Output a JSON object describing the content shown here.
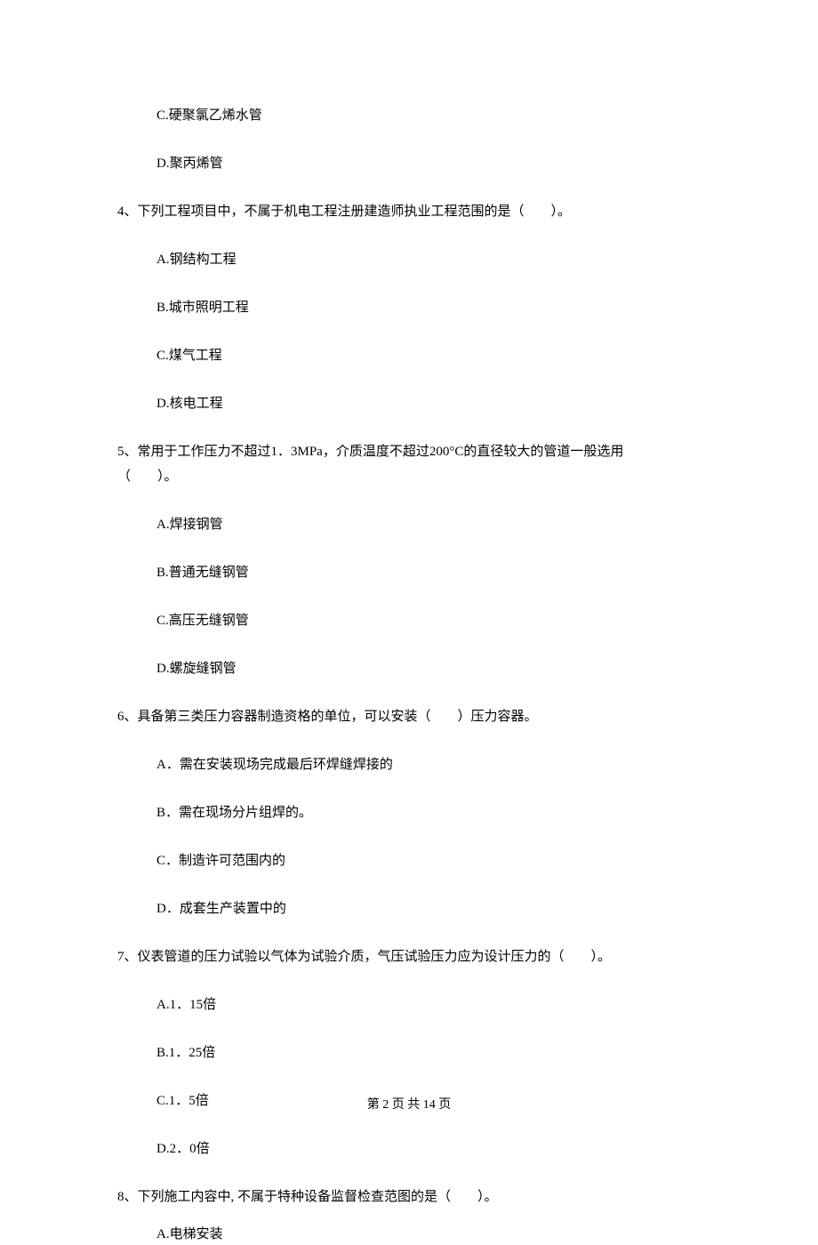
{
  "q3_continued": {
    "c": "C.硬聚氯乙烯水管",
    "d": "D.聚丙烯管"
  },
  "q4": {
    "stem": "4、下列工程项目中，不属于机电工程注册建造师执业工程范围的是（　　）。",
    "a": "A.钢结构工程",
    "b": "B.城市照明工程",
    "c": "C.煤气工程",
    "d": "D.核电工程"
  },
  "q5": {
    "stem1": "5、常用于工作压力不超过1．3MPa，介质温度不超过200°C的直径较大的管道一般选用",
    "stem2": "（　　）。",
    "a": "A.焊接钢管",
    "b": "B.普通无缝钢管",
    "c": "C.高压无缝钢管",
    "d": "D.螺旋缝钢管"
  },
  "q6": {
    "stem": "6、具备第三类压力容器制造资格的单位，可以安装（　　）压力容器。",
    "a": "A．需在安装现场完成最后环焊缝焊接的",
    "b": "B．需在现场分片组焊的。",
    "c": "C．制造许可范围内的",
    "d": "D．成套生产装置中的"
  },
  "q7": {
    "stem": "7、仪表管道的压力试验以气体为试验介质，气压试验压力应为设计压力的（　　）。",
    "a": "A.1．15倍",
    "b": "B.1．25倍",
    "c": "C.1．5倍",
    "d": "D.2．0倍"
  },
  "q8": {
    "stem": "8、下列施工内容中, 不属于特种设备监督检查范图的是（　　）。",
    "a": "A.电梯安装"
  },
  "footer": "第 2 页 共 14 页"
}
